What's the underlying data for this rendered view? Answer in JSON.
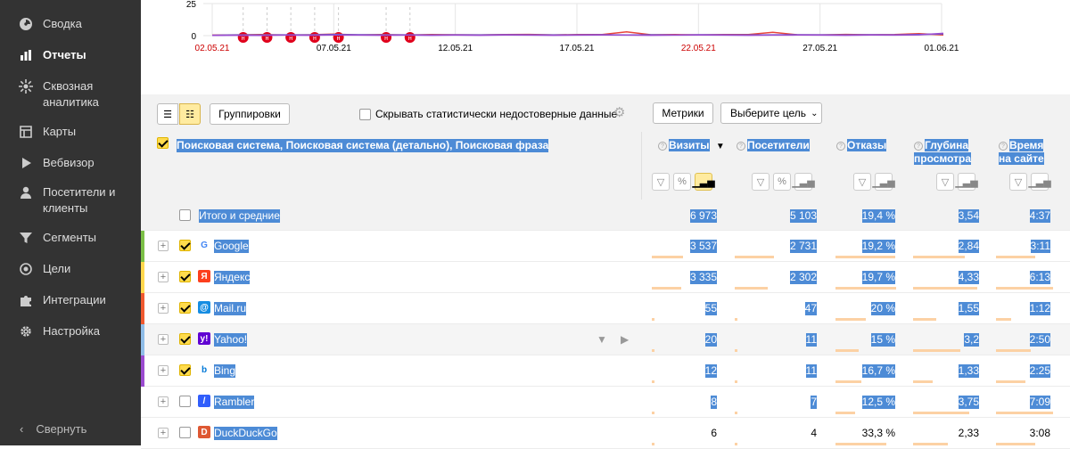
{
  "sidebar": {
    "items": [
      {
        "label": "Сводка",
        "icon": "dashboard-icon"
      },
      {
        "label": "Отчеты",
        "icon": "reports-icon"
      },
      {
        "label": "Сквозная аналитика",
        "icon": "analytics-icon"
      },
      {
        "label": "Карты",
        "icon": "maps-icon"
      },
      {
        "label": "Вебвизор",
        "icon": "webvisor-icon"
      },
      {
        "label": "Посетители и клиенты",
        "icon": "visitors-icon"
      },
      {
        "label": "Сегменты",
        "icon": "segments-icon"
      },
      {
        "label": "Цели",
        "icon": "goals-icon"
      },
      {
        "label": "Интеграции",
        "icon": "integrations-icon"
      },
      {
        "label": "Настройка",
        "icon": "settings-icon"
      }
    ],
    "collapse_label": "Свернуть"
  },
  "chart_data": {
    "type": "line",
    "x": [
      "02.05.21",
      "07.05.21",
      "12.05.21",
      "17.05.21",
      "22.05.21",
      "27.05.21",
      "01.06.21"
    ],
    "x_label_colors": [
      "#cc0000",
      "#000000",
      "#000000",
      "#000000",
      "#cc0000",
      "#000000",
      "#000000"
    ],
    "y_ticks": [
      "25",
      "0"
    ],
    "ylim": [
      0,
      25
    ],
    "holiday_marker": "н",
    "series": [
      {
        "color": "#e8443a",
        "values": [
          0.4,
          0.6,
          0.8,
          0.5,
          0.7,
          1.2,
          0.6,
          0.8,
          0.5,
          0.9,
          0.7,
          0.6,
          0.8,
          1.0,
          0.6,
          0.8,
          0.9,
          3.0,
          0.7,
          0.8,
          0.6,
          0.9,
          0.8,
          2.6,
          0.7,
          0.6,
          1.0,
          0.7,
          0.8,
          1.6,
          0.5
        ]
      },
      {
        "color": "#4a5fd6",
        "values": [
          0.3,
          0.5,
          0.4,
          0.6,
          0.5,
          0.8,
          0.7,
          0.5,
          0.6,
          0.4,
          0.6,
          0.5,
          0.7,
          0.6,
          0.5,
          0.6,
          0.7,
          0.5,
          0.6,
          0.5,
          0.7,
          0.6,
          0.5,
          0.6,
          0.7,
          0.6,
          0.5,
          0.7,
          0.6,
          0.8,
          1.4
        ]
      },
      {
        "color": "#9b4bd0",
        "values": [
          0.2,
          0.3,
          0.2,
          0.4,
          0.3,
          0.5,
          0.4,
          0.3,
          0.4,
          0.3,
          0.4,
          0.3,
          0.5,
          0.4,
          0.3,
          0.4,
          0.5,
          0.4,
          0.3,
          0.4,
          0.5,
          0.4,
          0.3,
          0.4,
          0.5,
          0.4,
          0.3,
          0.5,
          0.4,
          0.6,
          1.8
        ]
      }
    ]
  },
  "toolbar": {
    "groupings_label": "Группировки",
    "hide_unreliable_label": "Скрывать статистически недостоверные данные",
    "metrics_label": "Метрики",
    "goal_label": "Выберите цель"
  },
  "dimensions_header": "Поисковая система, Поисковая система (детально), Поисковая фраза",
  "metrics": [
    {
      "label": "Визиты",
      "sorted": true
    },
    {
      "label": "Посетители"
    },
    {
      "label": "Отказы"
    },
    {
      "label": "Глубина просмотра"
    },
    {
      "label": "Время на сайте"
    }
  ],
  "sort_indicator": "▼",
  "total": {
    "label": "Итого и средние",
    "values": [
      "6 973",
      "5 103",
      "19,4 %",
      "3,54",
      "4:37"
    ]
  },
  "rows": [
    {
      "name": "Google",
      "checked": true,
      "stripe": "#7cc047",
      "logo": "G",
      "logo_color": "#ffffff",
      "logo_text_color": "#4285f4",
      "values": [
        "3 537",
        "2 731",
        "19,2 %",
        "2,84",
        "3:11"
      ],
      "fill": [
        0.51,
        0.54,
        0.99,
        0.8,
        0.69
      ]
    },
    {
      "name": "Яндекс",
      "checked": true,
      "stripe": "#ffd84d",
      "logo": "Я",
      "logo_color": "#fc3f1d",
      "logo_text_color": "#ffffff",
      "values": [
        "3 335",
        "2 302",
        "19,7 %",
        "4,33",
        "6:13"
      ],
      "fill": [
        0.48,
        0.45,
        1.0,
        1.0,
        1.0
      ]
    },
    {
      "name": "Mail.ru",
      "checked": true,
      "stripe": "#f05a30",
      "logo": "@",
      "logo_color": "#168de2",
      "logo_text_color": "#ffffff",
      "values": [
        "55",
        "47",
        "20 %",
        "1,55",
        "1:12"
      ],
      "fill": [
        0.01,
        0.01,
        0.5,
        0.36,
        0.26
      ]
    },
    {
      "name": "Yahoo!",
      "checked": true,
      "stripe": "#8fbde8",
      "logo": "y!",
      "logo_color": "#6001d2",
      "logo_text_color": "#ffffff",
      "values": [
        "20",
        "11",
        "15 %",
        "3,2",
        "2:50"
      ],
      "fill": [
        0.01,
        0.01,
        0.38,
        0.74,
        0.61
      ]
    },
    {
      "name": "Bing",
      "checked": true,
      "stripe": "#9b4bd0",
      "logo": "b",
      "logo_color": "#ffffff",
      "logo_text_color": "#0078d7",
      "values": [
        "12",
        "11",
        "16,7 %",
        "1,33",
        "2:25"
      ],
      "fill": [
        0.005,
        0.005,
        0.42,
        0.31,
        0.52
      ]
    },
    {
      "name": "Rambler",
      "checked": false,
      "stripe": "",
      "logo": "/",
      "logo_color": "#315efb",
      "logo_text_color": "#ffffff",
      "values": [
        "8",
        "7",
        "12,5 %",
        "3,75",
        "7:09"
      ],
      "fill": [
        0.004,
        0.004,
        0.32,
        0.87,
        1.0
      ]
    },
    {
      "name": "DuckDuckGo",
      "checked": false,
      "stripe": "",
      "logo": "D",
      "logo_color": "#de5833",
      "logo_text_color": "#ffffff",
      "values": [
        "6",
        "4",
        "33,3 %",
        "2,33",
        "3:08"
      ],
      "fill": [
        0.003,
        0.002,
        0.84,
        0.54,
        0.68
      ]
    }
  ]
}
